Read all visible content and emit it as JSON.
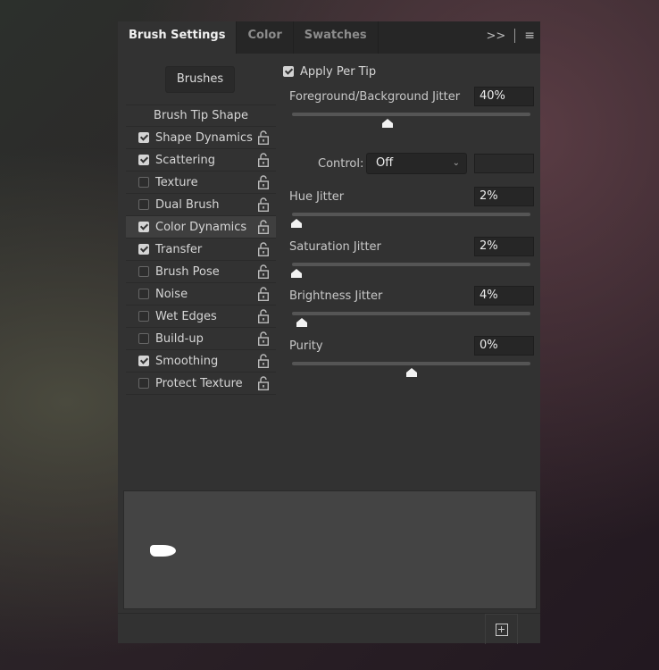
{
  "tabs": [
    {
      "label": "Brush Settings",
      "active": true
    },
    {
      "label": "Color"
    },
    {
      "label": "Swatches"
    }
  ],
  "tab_icons": {
    "collapse": ">>",
    "menu": "menu-icon"
  },
  "brushes_button": "Brushes",
  "list": {
    "header": "Brush Tip Shape",
    "items": [
      {
        "label": "Shape Dynamics",
        "checked": true
      },
      {
        "label": "Scattering",
        "checked": true
      },
      {
        "label": "Texture",
        "checked": false
      },
      {
        "label": "Dual Brush",
        "checked": false
      },
      {
        "label": "Color Dynamics",
        "checked": true,
        "selected": true
      },
      {
        "label": "Transfer",
        "checked": true
      },
      {
        "label": "Brush Pose",
        "checked": false
      },
      {
        "label": "Noise",
        "checked": false
      },
      {
        "label": "Wet Edges",
        "checked": false
      },
      {
        "label": "Build-up",
        "checked": false
      },
      {
        "label": "Smoothing",
        "checked": true
      },
      {
        "label": "Protect Texture",
        "checked": false
      }
    ]
  },
  "settings": {
    "apply_per_tip": {
      "label": "Apply Per Tip",
      "checked": true
    },
    "control": {
      "label": "Control:",
      "value": "Off"
    },
    "sliders": [
      {
        "label": "Foreground/Background Jitter",
        "value": "40%",
        "percent": 40
      },
      {
        "label": "Hue Jitter",
        "value": "2%",
        "percent": 2
      },
      {
        "label": "Saturation Jitter",
        "value": "2%",
        "percent": 2
      },
      {
        "label": "Brightness Jitter",
        "value": "4%",
        "percent": 4
      },
      {
        "label": "Purity",
        "value": "0%",
        "percent": 0,
        "range": [
          -100,
          100
        ]
      }
    ]
  }
}
